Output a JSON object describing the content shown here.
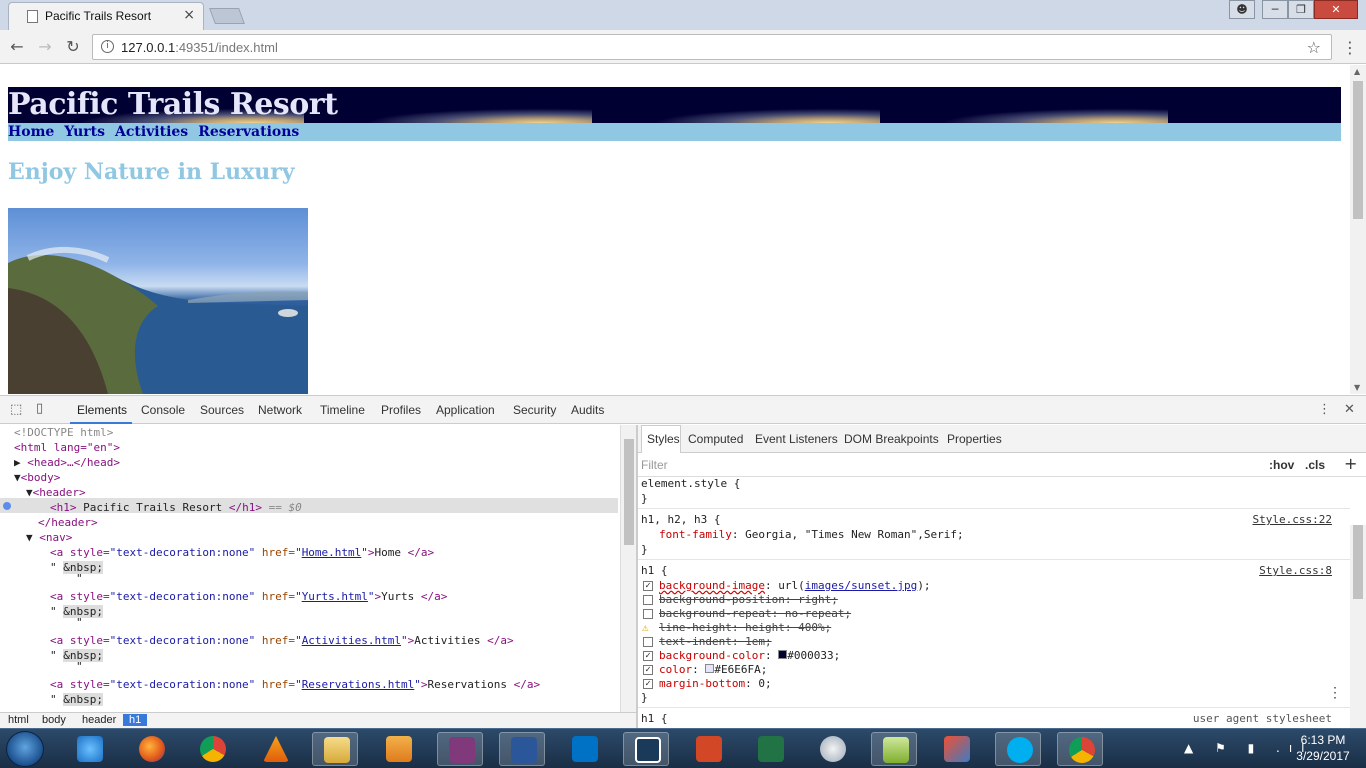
{
  "browser": {
    "tab_title": "Pacific Trails Resort",
    "tab_close": "×",
    "url_host": "127.0.0.1",
    "url_rest": ":49351/index.html",
    "back": "←",
    "forward": "→",
    "reload": "↻",
    "star": "☆",
    "menu": "⋮",
    "win_min": "─",
    "win_max": "❐",
    "win_close": "✕"
  },
  "page": {
    "header_title": "Pacific Trails Resort",
    "nav": [
      "Home",
      "Yurts",
      "Activities",
      "Reservations"
    ],
    "heading": "Enjoy Nature in Luxury",
    "header_bg": "#000033",
    "header_color": "#E6E6FA",
    "nav_bg": "#90c7e3",
    "nav_link_color": "#000099"
  },
  "devtools": {
    "tabs": [
      "Elements",
      "Console",
      "Sources",
      "Network",
      "Timeline",
      "Profiles",
      "Application",
      "Security",
      "Audits"
    ],
    "close": "✕",
    "menu": "⋮",
    "dom": {
      "doctype": "<!DOCTYPE html>",
      "html_open": "<html lang=\"en\">",
      "head": "<head>…</head>",
      "body": "<body>",
      "header": "<header>",
      "h1_open": "<h1>",
      "h1_text": " Pacific Trails Resort ",
      "h1_close": "</h1>",
      "h1_suffix": " == $0",
      "header_close": "</header>",
      "nav": "<nav>",
      "links": [
        {
          "href": "Home.html",
          "text": "Home "
        },
        {
          "href": "Yurts.html",
          "text": "Yurts "
        },
        {
          "href": "Activities.html",
          "text": "Activities "
        },
        {
          "href": "Reservations.html",
          "text": "Reservations "
        }
      ],
      "a_open_prefix": "<a style=",
      "a_style": "\"text-decoration:none\"",
      "a_href_attr": " href=",
      "a_close": "</a>",
      "nbsp": "&nbsp;",
      "quote": "\"",
      "quote_sp": "\" "
    },
    "breadcrumbs": [
      "html",
      "body",
      "header",
      "h1"
    ],
    "styles_tabs": [
      "Styles",
      "Computed",
      "Event Listeners",
      "DOM Breakpoints",
      "Properties"
    ],
    "filter_placeholder": "Filter",
    "hov": ":hov",
    "cls": ".cls",
    "plus": "+",
    "rules": {
      "element_style": "element.style {",
      "close": "}",
      "r1_selector": "h1, h2, h3 {",
      "r1_source": "Style.css:22",
      "r1_prop": "font-family",
      "r1_val": ": Georgia, \"Times New Roman\",Serif;",
      "r2_selector": "h1 {",
      "r2_source": "Style.css:8",
      "r2_lines": [
        {
          "prop": "background-image",
          "val": ": url(",
          "link": "images/sunset.jpg",
          "tail": ");",
          "checked": true,
          "strike": false,
          "warn": false
        },
        {
          "prop": "background-position",
          "val": ": right;",
          "checked": false,
          "strike": true,
          "warn": false
        },
        {
          "prop": "background-repeat",
          "val": ": no-repeat;",
          "checked": false,
          "strike": true,
          "warn": false
        },
        {
          "prop": "line-height",
          "val": ": height: 400%;",
          "checked": false,
          "strike": true,
          "warn": true
        },
        {
          "prop": "text-indent",
          "val": ": 1em;",
          "checked": false,
          "strike": true,
          "warn": false
        },
        {
          "prop": "background-color",
          "val": "#000033;",
          "checked": true,
          "strike": false,
          "warn": false,
          "swatch": "#000033"
        },
        {
          "prop": "color",
          "val": "#E6E6FA;",
          "checked": true,
          "strike": false,
          "warn": false,
          "swatch": "#E6E6FA"
        },
        {
          "prop": "margin-bottom",
          "val": ": 0;",
          "checked": true,
          "strike": false,
          "warn": false
        }
      ],
      "r3_selector": "h1 {",
      "r3_source": "user agent stylesheet"
    }
  },
  "taskbar": {
    "time": "6:13 PM",
    "date": "3/29/2017",
    "tray": "▲ ⚑ ▮ .ıl",
    "apps": [
      "internet-explorer",
      "firefox",
      "chrome",
      "vlc",
      "file-explorer",
      "media-player",
      "onenote",
      "word",
      "outlook",
      "notepad-app",
      "powerpoint",
      "excel",
      "paint-tool",
      "notepad-plus",
      "git-tool",
      "skype",
      "chrome-active"
    ]
  }
}
